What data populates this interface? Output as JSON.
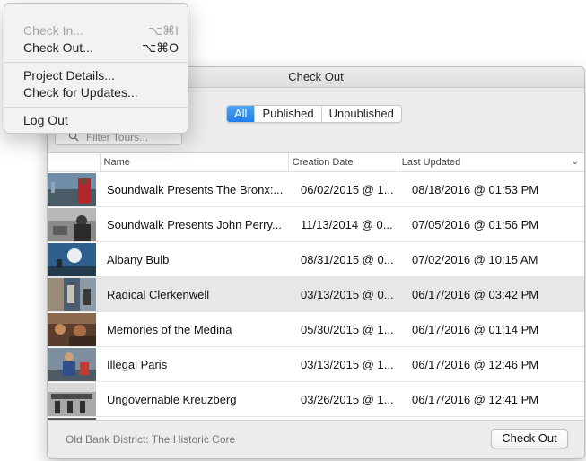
{
  "menu": {
    "items": [
      {
        "label": "Check In...",
        "shortcut": "⌥⌘I",
        "disabled": true
      },
      {
        "label": "Check Out...",
        "shortcut": "⌥⌘O",
        "disabled": false
      },
      {
        "label": "Project Details...",
        "shortcut": "",
        "disabled": false
      },
      {
        "label": "Check for Updates...",
        "shortcut": "",
        "disabled": false
      },
      {
        "label": "Log Out",
        "shortcut": "",
        "disabled": false
      }
    ]
  },
  "window": {
    "title": "Check Out",
    "filter_tabs": [
      "All",
      "Published",
      "Unpublished"
    ],
    "active_tab": "All",
    "search": {
      "placeholder": "Filter Tours..."
    },
    "columns": {
      "name": "Name",
      "created": "Creation Date",
      "updated": "Last Updated"
    },
    "rows": [
      {
        "name": "Soundwalk Presents The Bronx:...",
        "created": "06/02/2015 @ 1...",
        "updated": "08/18/2016 @ 01:53 PM",
        "selected": false
      },
      {
        "name": "Soundwalk Presents John Perry...",
        "created": "11/13/2014 @ 0...",
        "updated": "07/05/2016 @ 01:56 PM",
        "selected": false
      },
      {
        "name": "Albany Bulb",
        "created": "08/31/2015 @ 0...",
        "updated": "07/02/2016 @ 10:15 AM",
        "selected": false
      },
      {
        "name": "Radical Clerkenwell",
        "created": "03/13/2015 @ 0...",
        "updated": "06/17/2016 @ 03:42 PM",
        "selected": true
      },
      {
        "name": "Memories of the Medina",
        "created": "05/30/2015 @ 1...",
        "updated": "06/17/2016 @ 01:14 PM",
        "selected": false
      },
      {
        "name": "Illegal Paris",
        "created": "03/13/2015 @ 1...",
        "updated": "06/17/2016 @ 12:46 PM",
        "selected": false
      },
      {
        "name": "Ungovernable Kreuzberg",
        "created": "03/26/2015 @ 1...",
        "updated": "06/17/2016 @ 12:41 PM",
        "selected": false
      }
    ],
    "footer_label": "Old Bank District: The Historic Core",
    "check_out_button": "Check Out"
  },
  "colors": {
    "accent": "#1f7ef0",
    "selected_row": "#e7e7e7"
  }
}
